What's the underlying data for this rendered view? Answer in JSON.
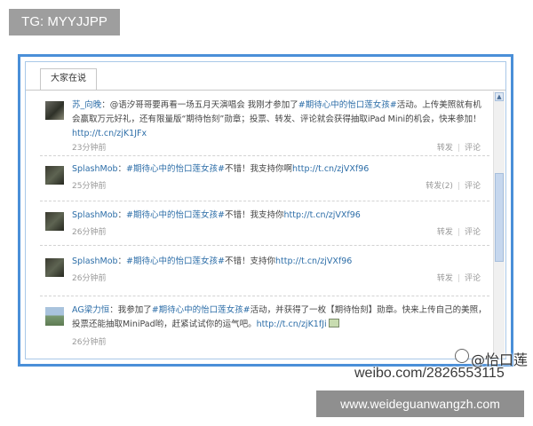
{
  "tag_badge": "TG: MYYJJPP",
  "widget": {
    "tab_label": "大家在说",
    "posts": [
      {
        "user": "苏_向晚",
        "text_pre": "：@语汐哥哥要再看一场五月天演唱会 我刚才参加了",
        "topic": "#期待心中的怡口莲女孩#",
        "text_post": "活动。上传美照就有机会赢取万元好礼，还有限量版“期待怡刻”勋章；投票、转发、评论就会获得抽取iPad Mini的机会，快来参加！",
        "link": "http://t.cn/zjK1JFx",
        "time": "23分钟前",
        "repost": "转发",
        "comment": "评论"
      },
      {
        "user": "SplashMob",
        "text_pre": "：",
        "topic": "#期待心中的怡口莲女孩#",
        "text_post": "不错！我支持你啊",
        "link": "http://t.cn/zjVXf96",
        "time": "25分钟前",
        "repost": "转发(2)",
        "comment": "评论"
      },
      {
        "user": "SplashMob",
        "text_pre": "：",
        "topic": "#期待心中的怡口莲女孩#",
        "text_post": "不错！我支持你",
        "link": "http://t.cn/zjVXf96",
        "time": "26分钟前",
        "repost": "转发",
        "comment": "评论"
      },
      {
        "user": "SplashMob",
        "text_pre": "：",
        "topic": "#期待心中的怡口莲女孩#",
        "text_post": "不错！支持你",
        "link": "http://t.cn/zjVXf96",
        "time": "26分钟前",
        "repost": "转发",
        "comment": "评论"
      },
      {
        "user": "AG梁力恒",
        "text_pre": "：我参加了",
        "topic": "#期待心中的怡口莲女孩#",
        "text_post": "活动，并获得了一枚【期待怡刻】勋章。快来上传自己的美照，投票还能抽取MiniPad哟，赶紧试试你的运气吧。",
        "link": "http://t.cn/zjK1fJi",
        "time": "26分钟前",
        "repost": "",
        "comment": ""
      }
    ]
  },
  "watermark": {
    "name": "怡口莲",
    "url": "weibo.com/2826553115"
  },
  "site_banner": "www.weideguanwangzh.com"
}
